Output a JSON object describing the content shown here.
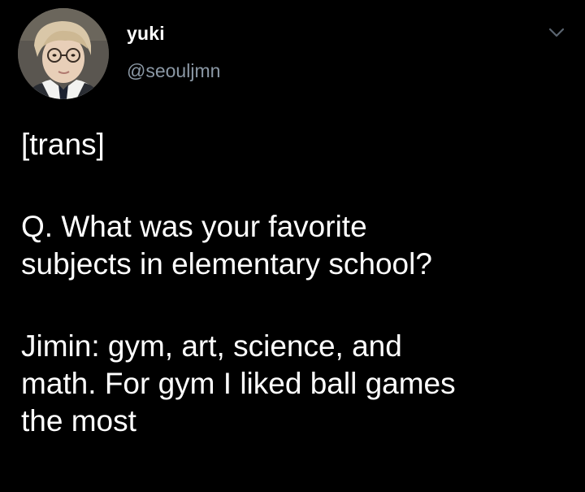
{
  "tweet": {
    "author": {
      "display_name": "yuki",
      "handle": "@seouljmn",
      "avatar_icon": "profile-photo"
    },
    "menu_icon": "chevron-down-icon",
    "text": {
      "line_trans": "[trans]",
      "question_line1": "Q. What was your favorite",
      "question_line2": "subjects in elementary school?",
      "answer_line1": "Jimin: gym, art, science, and",
      "answer_line2": "math. For gym I liked ball games",
      "answer_line3": "the most"
    }
  },
  "colors": {
    "background": "#000000",
    "text_primary": "#ffffff",
    "text_secondary": "#8b98a5"
  }
}
